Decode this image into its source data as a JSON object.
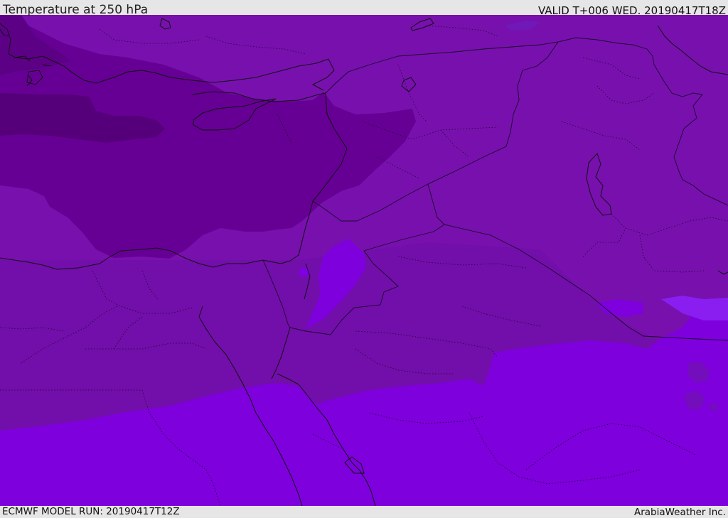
{
  "header": {
    "title": "Temperature at 250 hPa",
    "valid": "VALID T+006 WED. 20190417T18Z"
  },
  "footer": {
    "model_run": "ECMWF MODEL RUN: 20190417T12Z",
    "credit": "ArabiaWeather Inc."
  },
  "map": {
    "colors": {
      "darkest_band": "#55007a",
      "dark_band": "#660094",
      "mid_band": "#7810ae",
      "mid_dark_band": "#720eaa",
      "warm_band": "#7e00dc",
      "warm_patch": "#8a1ef0",
      "coastline": "#111111",
      "border": "#1a0a2a"
    }
  }
}
